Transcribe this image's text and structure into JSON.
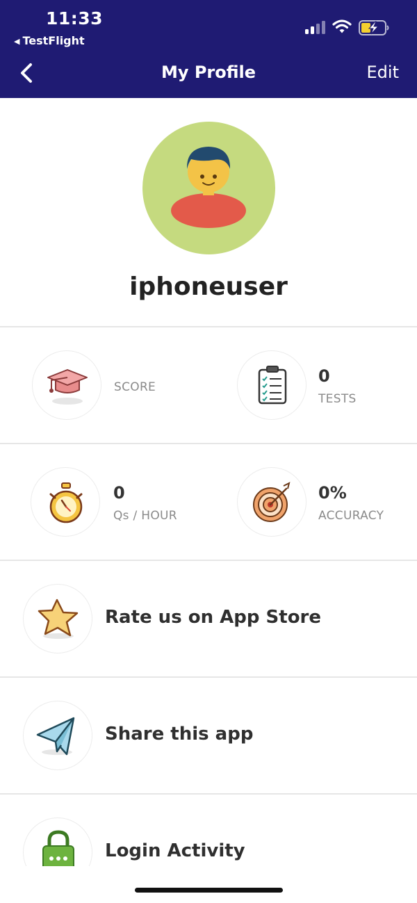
{
  "status_bar": {
    "time": "11:33",
    "back_app": "TestFlight",
    "icons": [
      "signal-icon",
      "wifi-icon",
      "battery-charging-icon"
    ]
  },
  "nav": {
    "title": "My Profile",
    "edit_label": "Edit",
    "back_icon": "chevron-left-icon"
  },
  "profile": {
    "username": "iphoneuser",
    "avatar_icon": "user-avatar-icon"
  },
  "stats": [
    {
      "id": "score",
      "icon": "graduation-cap-icon",
      "value": "",
      "label": "SCORE"
    },
    {
      "id": "tests",
      "icon": "clipboard-checklist-icon",
      "value": "0",
      "label": "TESTS"
    },
    {
      "id": "qs_per_hour",
      "icon": "stopwatch-icon",
      "value": "0",
      "label": "Qs / HOUR"
    },
    {
      "id": "accuracy",
      "icon": "target-icon",
      "value": "0%",
      "label": "ACCURACY"
    }
  ],
  "menu": [
    {
      "id": "rate",
      "icon": "star-icon",
      "label": "Rate us on App Store"
    },
    {
      "id": "share",
      "icon": "paper-plane-icon",
      "label": "Share this app"
    },
    {
      "id": "login_activity",
      "icon": "lock-icon",
      "label": "Login Activity"
    }
  ],
  "colors": {
    "header_bg": "#1f1b73",
    "avatar_bg": "#c5da7f",
    "avatar_shirt": "#e35a4a",
    "divider": "#e6e6e6",
    "battery_fill": "#f5d02f"
  }
}
